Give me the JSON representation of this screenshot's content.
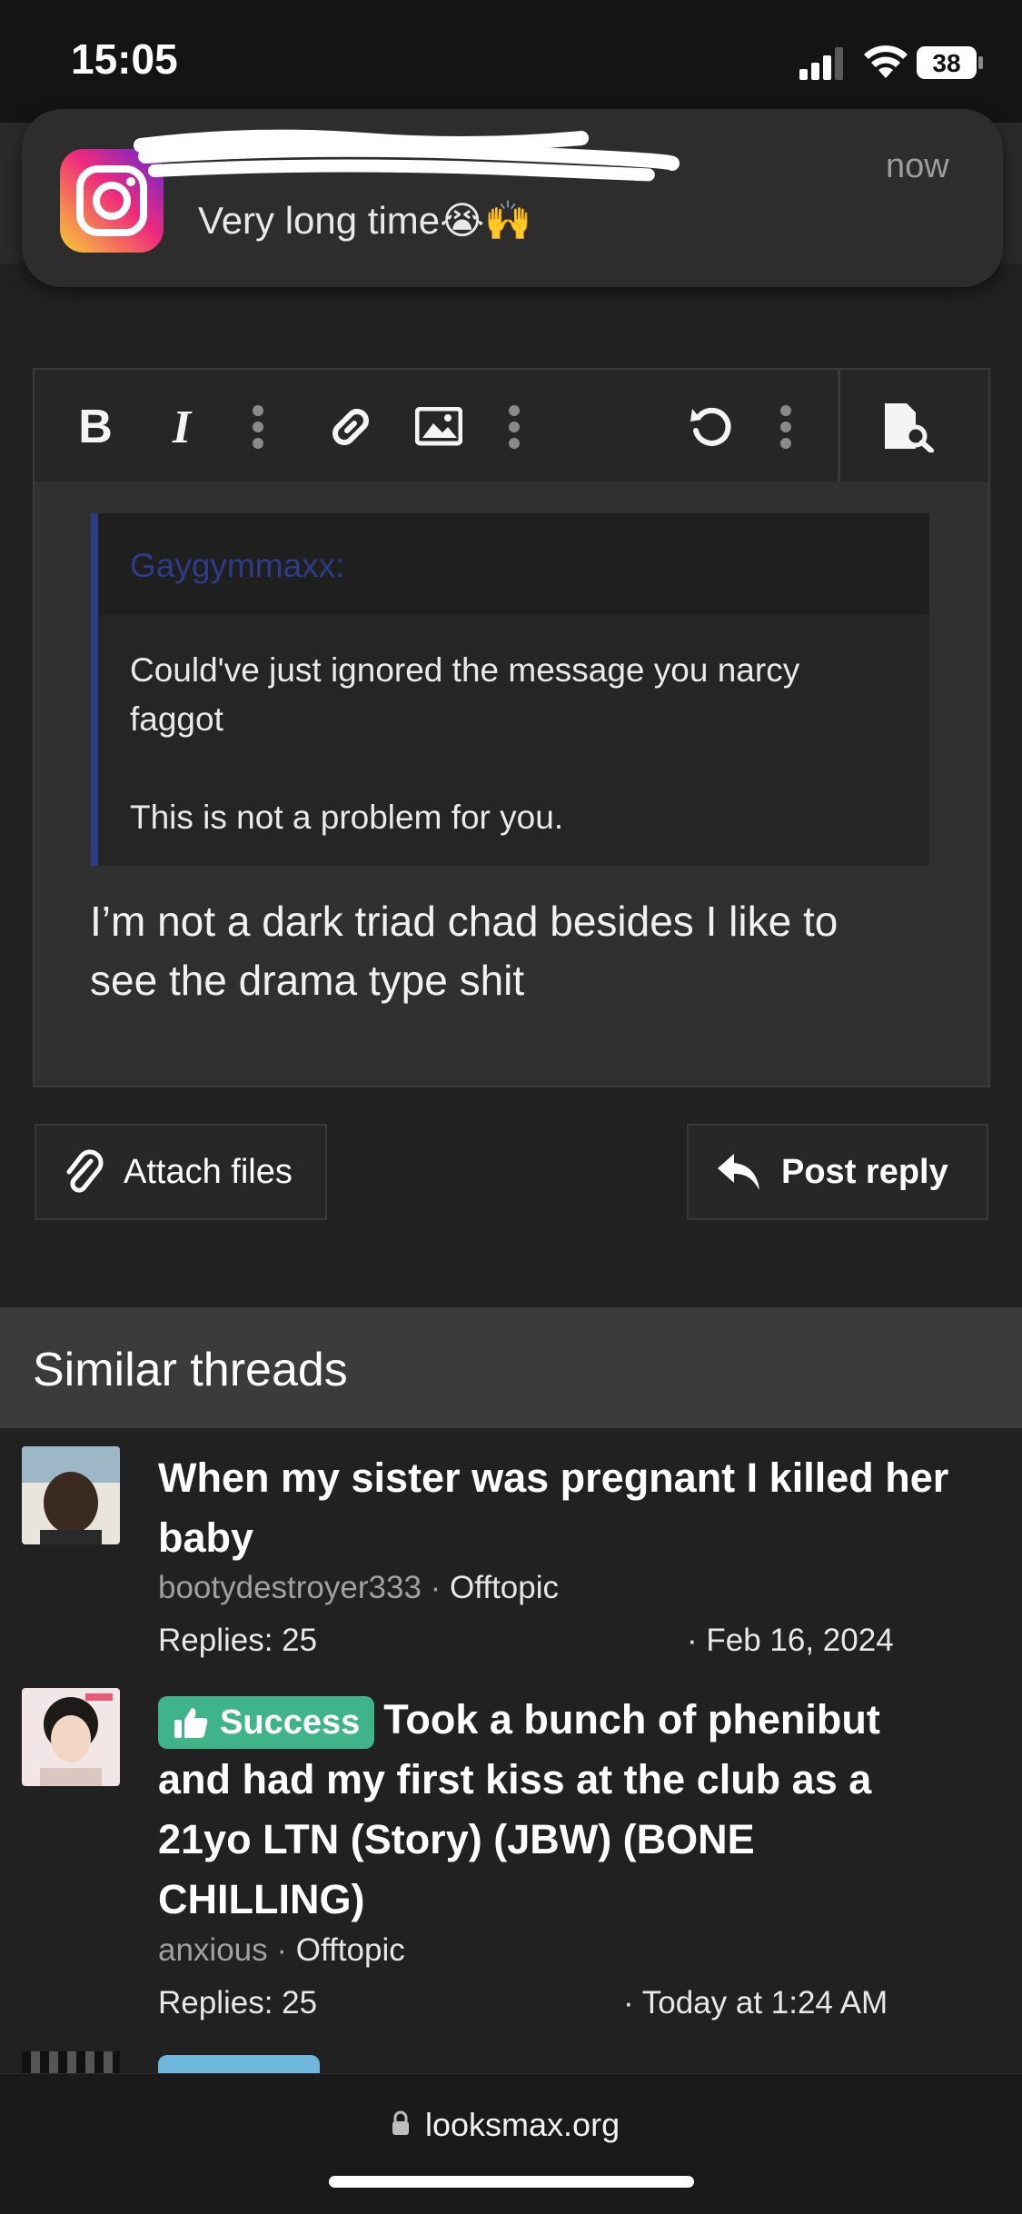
{
  "status_bar": {
    "time": "15:05",
    "battery": "38"
  },
  "notification": {
    "app_icon": "instagram-icon",
    "message": "Very long time😭🙌",
    "time": "now"
  },
  "editor": {
    "toolbar": {
      "bold": "B",
      "italic": "I",
      "icons": [
        "more-vertical-icon",
        "link-icon",
        "image-icon",
        "more-vertical-icon",
        "undo-icon",
        "more-vertical-icon",
        "preview-icon"
      ]
    },
    "quote": {
      "author": "Gaygymmaxx:",
      "lines": [
        "Could've just ignored the message you narcy",
        "faggot",
        "This is not a problem for you."
      ]
    },
    "reply_lines": [
      "I’m not a dark triad chad besides I like to",
      "see the drama type shit"
    ]
  },
  "buttons": {
    "attach": "Attach files",
    "post": "Post reply"
  },
  "similar_threads": {
    "heading": "Similar threads",
    "threads": [
      {
        "title_lines": [
          "When my sister was pregnant I killed her",
          "baby"
        ],
        "author": "bootydestroyer333",
        "forum": "Offtopic",
        "replies": "Replies: 25",
        "date": "· Feb 16, 2024"
      },
      {
        "prefix": "Success",
        "title_lines": [
          "Took a bunch of phenibut",
          "and had my first kiss at the club as a",
          "21yo LTN (Story) (JBW) (BONE",
          "CHILLING)"
        ],
        "author": "anxious",
        "forum": "Offtopic",
        "replies": "Replies: 25",
        "date": "· Today at 1:24 AM"
      }
    ]
  },
  "url_bar": {
    "domain": "looksmax.org"
  },
  "colors": {
    "success_badge": "#3fb38a",
    "quote_accent": "#2f3b82",
    "background": "#212121"
  }
}
